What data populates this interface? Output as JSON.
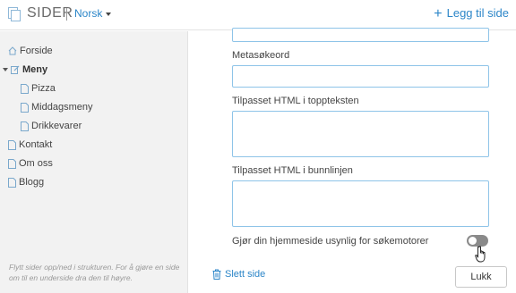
{
  "header": {
    "app_title": "SIDER",
    "language": "Norsk",
    "add_page_label": "Legg til side"
  },
  "sidebar": {
    "items": [
      {
        "label": "Forside",
        "icon": "home-icon"
      },
      {
        "label": "Meny",
        "icon": "edit-icon",
        "expanded": true,
        "selected": true
      },
      {
        "label": "Pizza",
        "icon": "page-icon"
      },
      {
        "label": "Middagsmeny",
        "icon": "page-icon"
      },
      {
        "label": "Drikkevarer",
        "icon": "page-icon"
      },
      {
        "label": "Kontakt",
        "icon": "page-icon"
      },
      {
        "label": "Om oss",
        "icon": "page-icon"
      },
      {
        "label": "Blogg",
        "icon": "page-icon"
      }
    ],
    "hint": "Flytt sider opp/ned i strukturen. For å gjøre en side om til en underside dra den til høyre."
  },
  "form": {
    "meta_keywords_label": "Metasøkeord",
    "meta_keywords_value": "",
    "header_html_label": "Tilpasset HTML i toppteksten",
    "header_html_value": "",
    "footer_html_label": "Tilpasset HTML i bunnlinjen",
    "footer_html_value": "",
    "hide_from_search_label": "Gjør din hjemmeside usynlig for søkemotorer",
    "hide_from_search_enabled": false
  },
  "footer": {
    "delete_label": "Slett side",
    "close_label": "Lukk"
  },
  "colors": {
    "accent": "#2c86c8",
    "field_border": "#8ec4e8",
    "toggle_off": "#8a8a8a",
    "sidebar_bg": "#f2f2f2"
  }
}
